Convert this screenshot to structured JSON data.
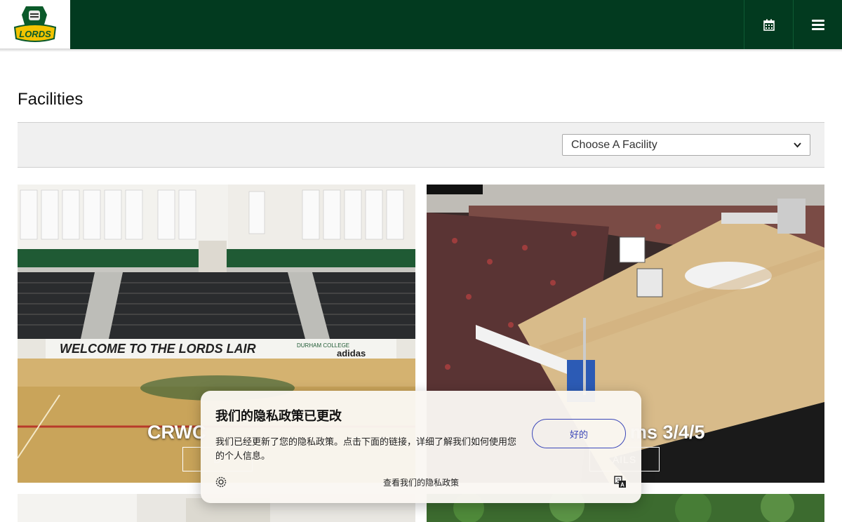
{
  "header": {
    "logo_text": "LORDS",
    "calendar_icon": "calendar-icon",
    "menu_icon": "hamburger-menu-icon"
  },
  "page": {
    "title": "Facilities"
  },
  "filter": {
    "select_value": "Choose A Facility",
    "select_icon": "chevron-down-icon"
  },
  "cards": [
    {
      "title": "CRWC",
      "button": "D"
    },
    {
      "title": "ms 3/4/5",
      "button": "AILS"
    }
  ],
  "photo_text": {
    "banner": "WELCOME TO THE LORDS LAIR",
    "banner_college": "DURHAM COLLEGE",
    "banner_brand": "adidas"
  },
  "consent": {
    "title": "我们的隐私政策已更改",
    "body": "我们已经更新了您的隐私政策。点击下面的链接，详细了解我们如何使用您的个人信息。",
    "ok_label": "好的",
    "link_label": "查看我们的隐私政策",
    "left_icon": "settings-gear-icon",
    "right_icon": "translate-icon"
  },
  "colors": {
    "header_bg": "#023a1f",
    "accent_blue": "#3a46b8",
    "filter_bg": "#f0f0f0"
  }
}
